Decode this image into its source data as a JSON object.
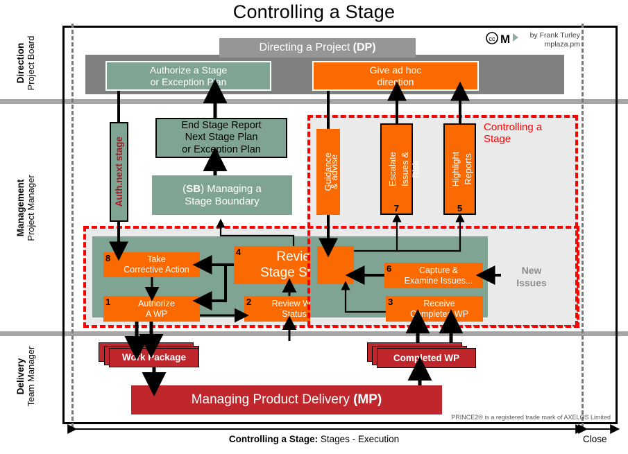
{
  "title": "Controlling a Stage",
  "credit": {
    "line1": "by Frank Turley",
    "line2": "mplaza.pm",
    "logo": "cc-mp-logo"
  },
  "lanes": [
    {
      "big": "Direction",
      "small": "Project Board"
    },
    {
      "big": "Management",
      "small": "Project Manager"
    },
    {
      "big": "Delivery",
      "small": "Team Manager"
    }
  ],
  "direction": {
    "process_bar": "Directing a Project (DP)",
    "process_bar_plain": "Directing a Project ",
    "process_bar_bold": "(DP)",
    "authorize_stage": {
      "line1": "Authorize a Stage",
      "line2": "or Exception Plan"
    },
    "ad_hoc": {
      "line1": "Give ad hoc",
      "line2": "direction"
    }
  },
  "management": {
    "auth_next_stage": "Auth.next stage",
    "end_stage_report": {
      "line1": "End Stage Report",
      "line2": "Next Stage Plan",
      "line3": "or Exception Plan"
    },
    "managing_stage_boundary": {
      "prefix": "(",
      "bold": "SB",
      "suffix": ") Managing  a",
      "line2": "Stage  Boundary"
    },
    "guidance": {
      "line1": "Guidance",
      "line2": "& advise"
    },
    "escalate": {
      "line1": "Escalate",
      "line2": "Issues & Risk",
      "number": "7"
    },
    "highlight": {
      "line1": "Highlight",
      "line2": "Reports",
      "number": "5"
    },
    "region_label": {
      "line1": "Controlling a",
      "line2": "Stage"
    },
    "new_issues": {
      "line1": "New",
      "line2": "Issues"
    },
    "activities": [
      {
        "number": "8",
        "line1": "Take",
        "line2": "Corrective Action"
      },
      {
        "number": "4",
        "line1": "Review",
        "line2": "Stage Status"
      },
      {
        "number": "1",
        "line1": "Authorize",
        "line2": "A WP"
      },
      {
        "number": "2",
        "line1": "Review WP",
        "line2": "Status"
      },
      {
        "number": "6",
        "line1": "Capture &",
        "line2": "Examine Issues..."
      },
      {
        "number": "3",
        "line1": "Receive",
        "line2": "Completed WP"
      }
    ]
  },
  "delivery": {
    "work_package": "Work Package",
    "completed_wp": "Completed WP",
    "managing_product_delivery_plain": "Managing Product Delivery ",
    "managing_product_delivery_bold": "(MP)"
  },
  "footer": {
    "trademark": "PRINCE2® is a registered trade mark of AXELOS Limited",
    "caption_bold": "Controlling a Stage:",
    "caption_rest": "  Stages - Execution",
    "close": "Close"
  },
  "colors": {
    "orange": "#fb6a00",
    "green": "#7fa493",
    "red": "#c0272d",
    "grey_bar": "#808080",
    "grey_process": "#969696",
    "region_red": "#ff0000",
    "region_bg": "#eaeaea"
  }
}
